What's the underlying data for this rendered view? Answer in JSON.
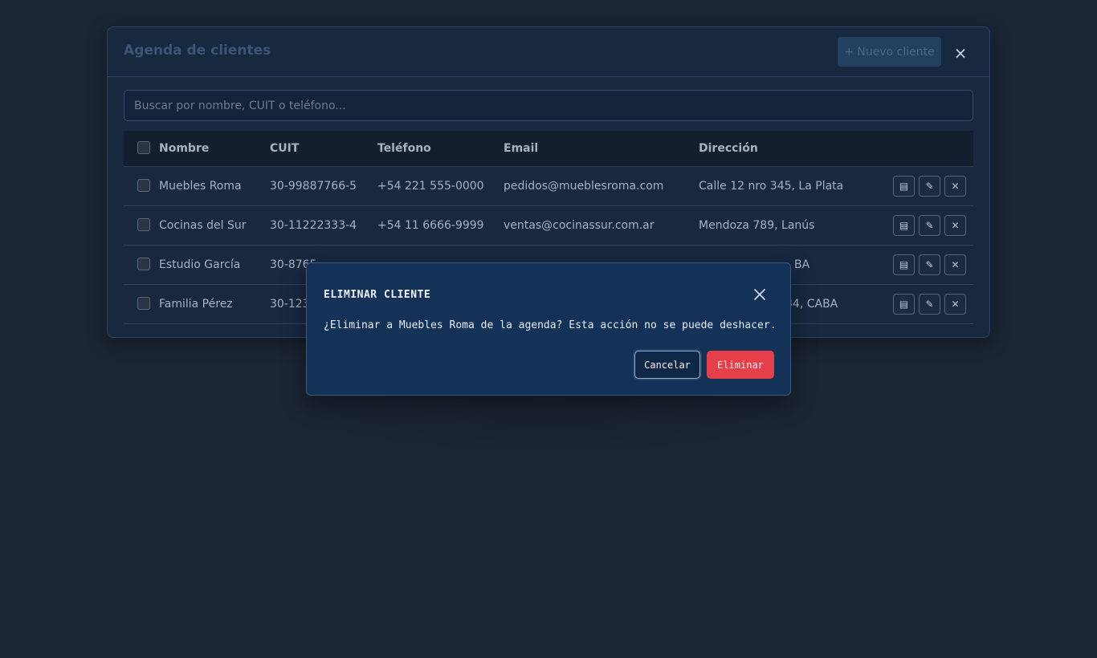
{
  "panel": {
    "title": "Agenda de clientes",
    "new_button": "+ Nuevo cliente",
    "close_glyph": "×",
    "search_placeholder": "Buscar por nombre, CUIT o teléfono..."
  },
  "table": {
    "headers": [
      "Nombre",
      "CUIT",
      "Teléfono",
      "Email",
      "Dirección"
    ],
    "rows": [
      {
        "nombre": "Muebles Roma",
        "cuit": "30-99887766-5",
        "telefono": "+54 221 555-0000",
        "email": "pedidos@mueblesroma.com",
        "direccion": "Calle 12 nro 345, La Plata"
      },
      {
        "nombre": "Cocinas del Sur",
        "cuit": "30-11222333-4",
        "telefono": "+54 11 6666-9999",
        "email": "ventas@cocinassur.com.ar",
        "direccion": "Mendoza 789, Lanús"
      },
      {
        "nombre": "Estudio García",
        "cuit": "30-8765",
        "telefono": "",
        "email": "",
        "direccion": "BA"
      },
      {
        "nombre": "Familia Pérez",
        "cuit": "30-123",
        "telefono": "",
        "email": "",
        "direccion": "34, CABA"
      }
    ],
    "row_actions": [
      {
        "icon": "list-icon",
        "glyph": "▤"
      },
      {
        "icon": "pencil-icon",
        "glyph": "✎"
      },
      {
        "icon": "close-icon",
        "glyph": "✕"
      }
    ]
  },
  "dialog": {
    "title": "ELIMINAR CLIENTE",
    "message": "¿Eliminar a Muebles Roma de la agenda? Esta acción no se puede deshacer.",
    "cancel_label": "Cancelar",
    "delete_label": "Eliminar"
  },
  "colors": {
    "background": "#1b2533",
    "panel": "#17283f",
    "dialog": "#143158",
    "danger": "#e5404a"
  }
}
